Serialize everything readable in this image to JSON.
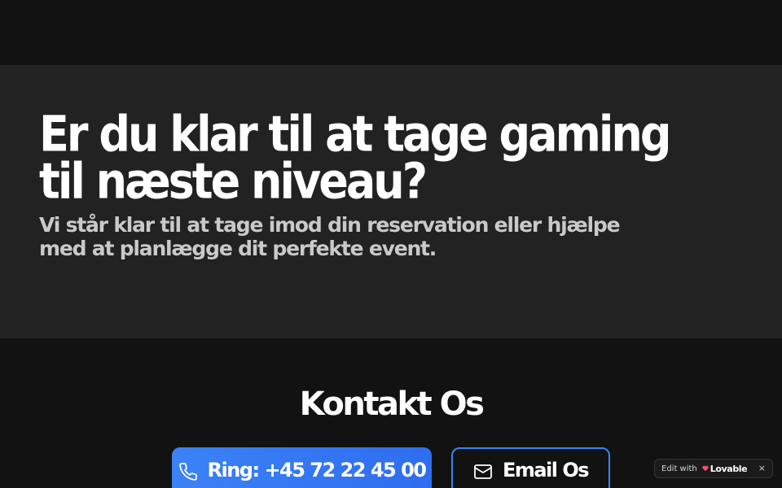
{
  "hero": {
    "title": "Er du klar til at tage gaming til næste niveau?",
    "subtitle": "Vi står klar til at tage imod din reservation eller hjælpe med at planlægge dit perfekte event."
  },
  "contact": {
    "title": "Kontakt Os",
    "call_label": "Ring: +45 72 22 45 00",
    "email_label": "Email Os"
  },
  "badge": {
    "prefix": "Edit with",
    "brand": "Lovable",
    "close": "×"
  },
  "icons": {
    "call": "phone-icon",
    "email": "mail-icon",
    "brand": "heart-icon",
    "close": "close-icon"
  },
  "colors": {
    "page_bg": "#121212",
    "hero_bg": "#222222",
    "accent": "#3b82f6",
    "subtitle": "#c9c9c9",
    "brand_heart": "#ff4f6d"
  }
}
